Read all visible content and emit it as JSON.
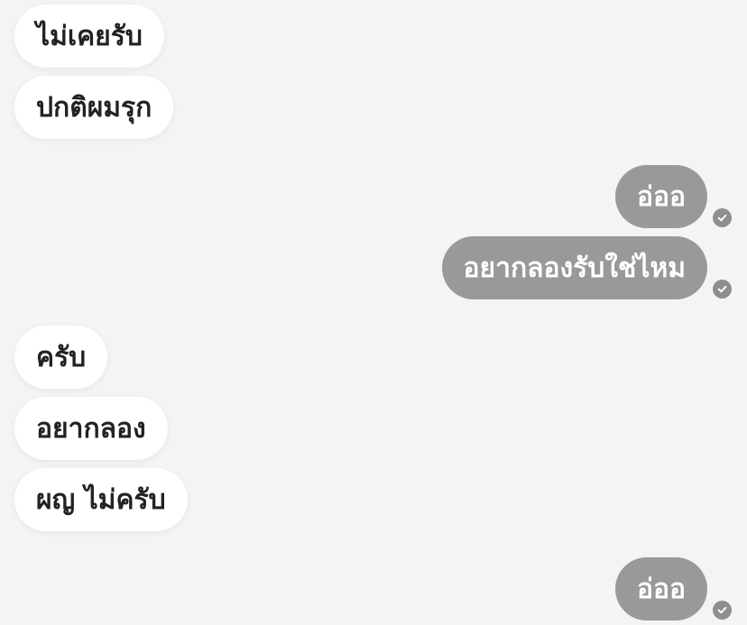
{
  "messages": [
    {
      "side": "incoming",
      "text": "ไม่เคยรับ"
    },
    {
      "side": "incoming",
      "text": "ปกติผมรุก"
    },
    {
      "side": "outgoing",
      "text": "อ่ออ",
      "status_icon": "check-circle-icon"
    },
    {
      "side": "outgoing",
      "text": "อยากลองรับใช่ไหม",
      "status_icon": "check-circle-icon"
    },
    {
      "side": "incoming",
      "text": "ครับ"
    },
    {
      "side": "incoming",
      "text": "อยากลอง"
    },
    {
      "side": "incoming",
      "text": "ผญ ไม่ครับ"
    },
    {
      "side": "outgoing",
      "text": "อ่ออ",
      "status_icon": "check-circle-icon"
    }
  ],
  "colors": {
    "background": "#f4f4f4",
    "incoming_bubble": "#ffffff",
    "incoming_text": "#222222",
    "outgoing_bubble": "#999999",
    "outgoing_text": "#ffffff",
    "read_check": "#8e8e8e"
  }
}
